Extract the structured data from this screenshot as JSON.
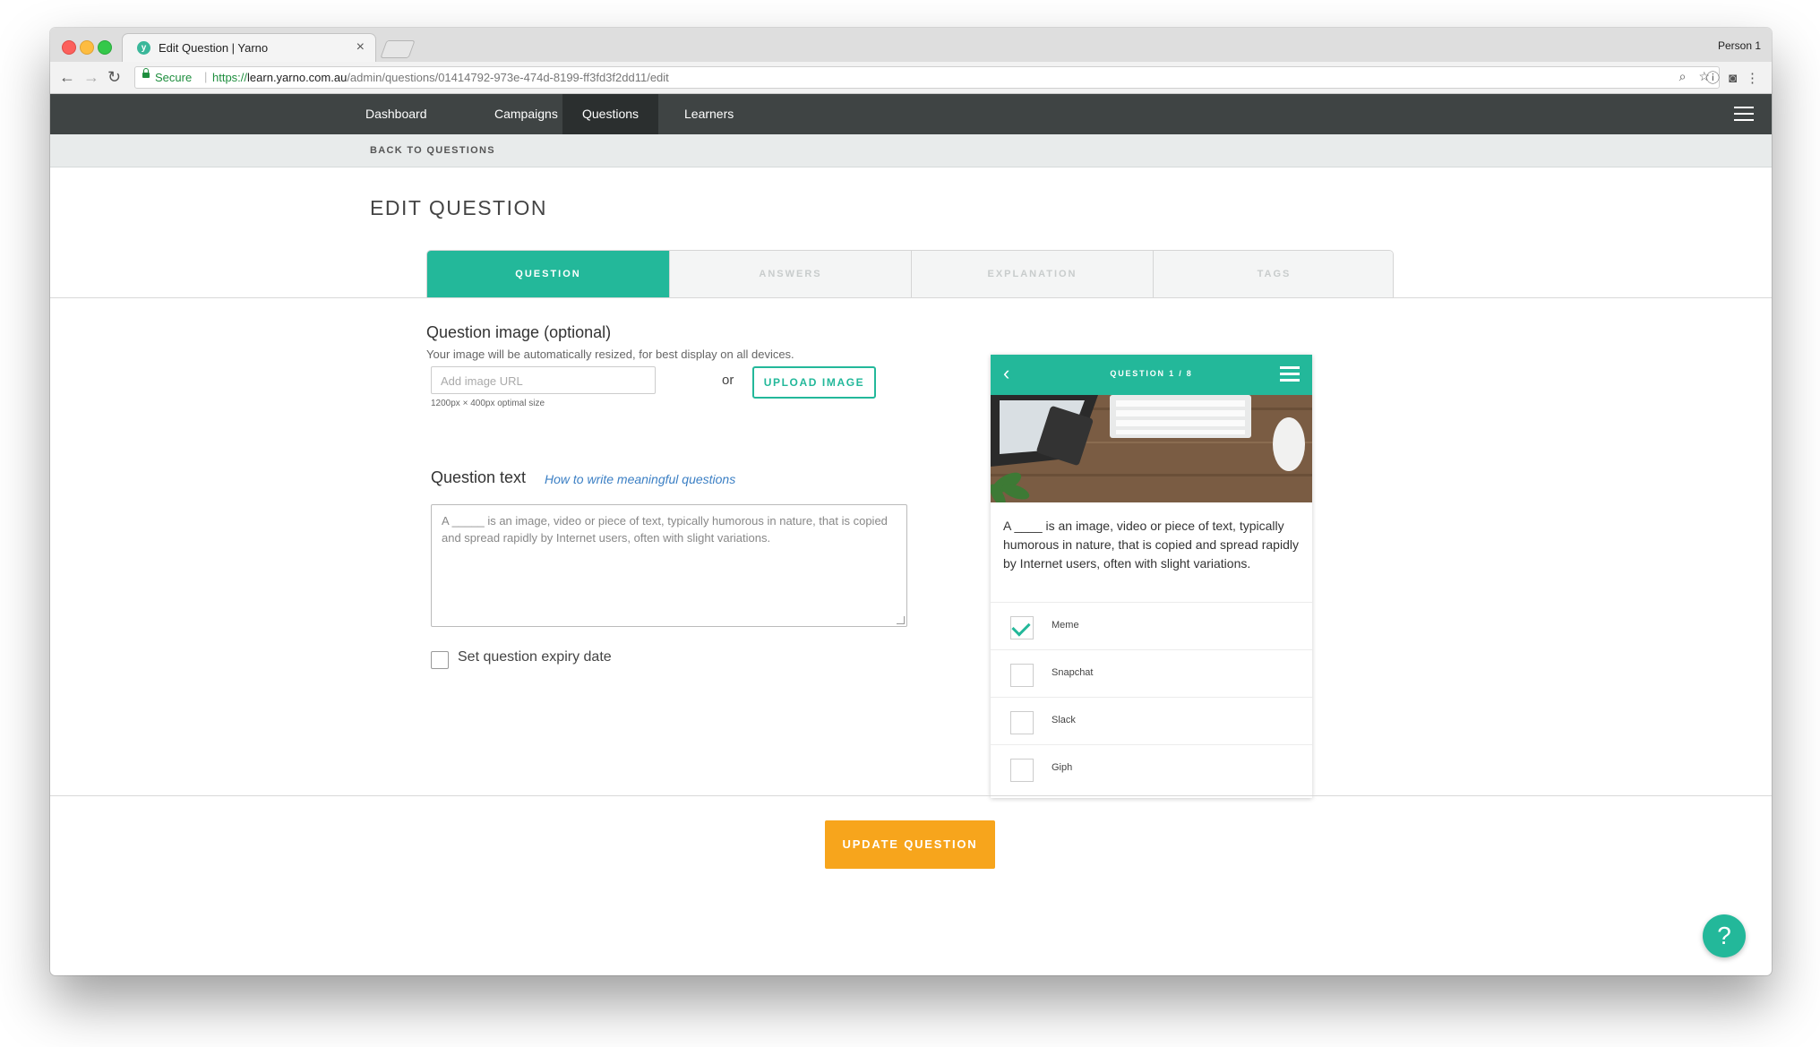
{
  "browser": {
    "tab_title": "Edit Question | Yarno",
    "tab_close": "×",
    "favicon_letter": "y",
    "profile": "Person 1",
    "secure_label": "Secure",
    "url_protocol": "https://",
    "url_domain": "learn.yarno.com.au",
    "url_path": "/admin/questions/01414792-973e-474d-8199-ff3fd3f2dd11/edit",
    "back": "←",
    "forward": "→",
    "reload": "↻"
  },
  "nav": {
    "items": [
      {
        "label": "Dashboard"
      },
      {
        "label": "Campaigns"
      },
      {
        "label": "Questions",
        "active": true
      },
      {
        "label": "Learners"
      }
    ]
  },
  "back_link": "BACK TO QUESTIONS",
  "page_title": "EDIT QUESTION",
  "steps": [
    {
      "label": "QUESTION",
      "active": true
    },
    {
      "label": "ANSWERS"
    },
    {
      "label": "EXPLANATION"
    },
    {
      "label": "TAGS"
    }
  ],
  "form": {
    "image_heading": "Question image (optional)",
    "image_help": "Your image will be automatically resized, for best display on all devices.",
    "image_url_placeholder": "Add image URL",
    "image_size_hint": "1200px × 400px optimal size",
    "or_label": "or",
    "upload_label": "UPLOAD IMAGE",
    "text_heading": "Question text",
    "text_help_link": "How to write meaningful questions",
    "question_text": "A _____ is an image, video or piece of text, typically humorous in nature, that is copied and spread rapidly by Internet users, often with slight variations.",
    "expiry_label": "Set question expiry date",
    "expiry_checked": false
  },
  "preview": {
    "title": "QUESTION 1 / 8",
    "back": "‹",
    "question": "A ____ is an image, video or piece of text, typically humorous in nature, that is copied and spread rapidly by Internet users, often with slight variations.",
    "options": [
      {
        "label": "Meme",
        "checked": true
      },
      {
        "label": "Snapchat",
        "checked": false
      },
      {
        "label": "Slack",
        "checked": false
      },
      {
        "label": "Giph",
        "checked": false
      }
    ]
  },
  "update_label": "UPDATE QUESTION",
  "help_fab": "?",
  "colors": {
    "accent": "#23b89a",
    "cta": "#f7a51c",
    "nav_bg": "#3f4444"
  }
}
